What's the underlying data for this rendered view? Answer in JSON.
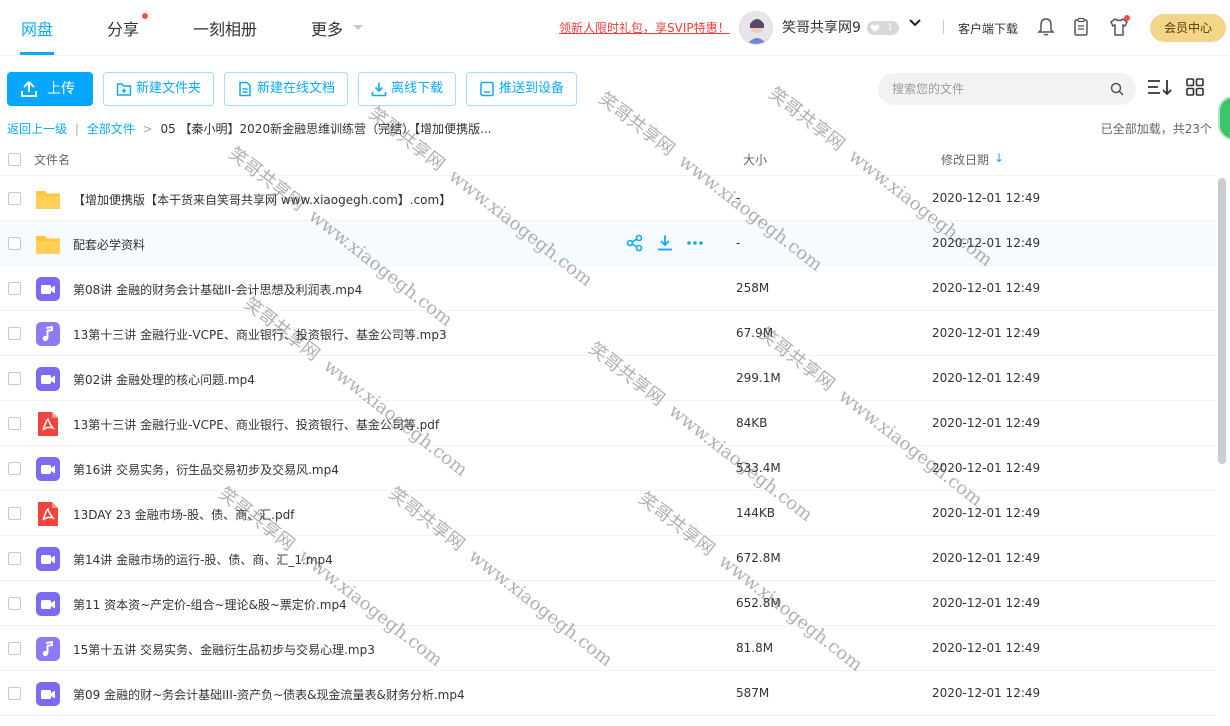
{
  "nav": {
    "tabs": [
      {
        "label": "网盘"
      },
      {
        "label": "分享"
      },
      {
        "label": "一刻相册"
      },
      {
        "label": "更多"
      }
    ],
    "promo": "领新人限时礼包，享SVIP特惠！",
    "username": "笑哥共享网9",
    "vip_level": "1",
    "client_download": "客户端下载",
    "member_center": "会员中心"
  },
  "toolbar": {
    "upload": "上传",
    "new_folder": "新建文件夹",
    "new_doc": "新建在线文档",
    "offline_download": "离线下载",
    "push_device": "推送到设备",
    "search_placeholder": "搜索您的文件"
  },
  "breadcrumb": {
    "back": "返回上一级",
    "all_files": "全部文件",
    "current": "05 【秦小明】2020新金融思维训练营（完结）【增加便携版..."
  },
  "status": "已全部加载，共23个",
  "columns": {
    "name": "文件名",
    "size": "大小",
    "modified": "修改日期"
  },
  "files": [
    {
      "type": "folder",
      "name": "【增加便携版【本干货来自笑哥共享网 www.xiaogegh.com】.com】",
      "size": "-",
      "date": "2020-12-01 12:49"
    },
    {
      "type": "folder",
      "name": "配套必学资料",
      "size": "-",
      "date": "2020-12-01 12:49"
    },
    {
      "type": "video",
      "name": "第08讲 金融的财务会计基础II-会计思想及利润表.mp4",
      "size": "258M",
      "date": "2020-12-01 12:49"
    },
    {
      "type": "audio",
      "name": "13第十三讲 金融行业-VCPE、商业银行、投资银行、基金公司等.mp3",
      "size": "67.9M",
      "date": "2020-12-01 12:49"
    },
    {
      "type": "video",
      "name": "第02讲 金融处理的核心问题.mp4",
      "size": "299.1M",
      "date": "2020-12-01 12:49"
    },
    {
      "type": "pdf",
      "name": "13第十三讲 金融行业-VCPE、商业银行、投资银行、基金公司等.pdf",
      "size": "84KB",
      "date": "2020-12-01 12:49"
    },
    {
      "type": "video",
      "name": "第16讲 交易实务，衍生品交易初步及交易风.mp4",
      "size": "533.4M",
      "date": "2020-12-01 12:49"
    },
    {
      "type": "pdf",
      "name": "13DAY 23 金融市场-股、债、商、汇.pdf",
      "size": "144KB",
      "date": "2020-12-01 12:49"
    },
    {
      "type": "video",
      "name": "第14讲 金融市场的运行-股、债、商、汇_1.mp4",
      "size": "672.8M",
      "date": "2020-12-01 12:49"
    },
    {
      "type": "video",
      "name": "第11 资本资~产定价-组合~理论&股~票定价.mp4",
      "size": "652.8M",
      "date": "2020-12-01 12:49"
    },
    {
      "type": "audio",
      "name": "15第十五讲 交易实务、金融衍生品初步与交易心理.mp3",
      "size": "81.8M",
      "date": "2020-12-01 12:49"
    },
    {
      "type": "video",
      "name": "第09 金融的财~务会计基础III-资产负~债表&现金流量表&财务分析.mp4",
      "size": "587M",
      "date": "2020-12-01 12:49"
    }
  ],
  "watermarks": {
    "brand": "笑哥共享网",
    "url": "www.xiaogegh.com"
  },
  "colors": {
    "accent": "#09aaff",
    "folder": "#ffc740",
    "video": "#7a6bf0",
    "audio": "#8c7bf5",
    "pdf": "#f1443d"
  }
}
